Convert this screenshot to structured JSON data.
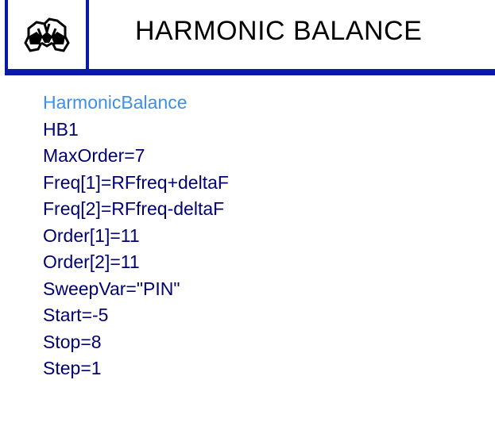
{
  "colors": {
    "accent": "#0a1aa8",
    "component_type": "#3f8fe6",
    "parameter_text": "#000070",
    "title_text": "#000000",
    "background": "#ffffff"
  },
  "header": {
    "icon": "harmonic-balance-simulation-icon",
    "title": "HARMONIC BALANCE"
  },
  "component": {
    "type": "HarmonicBalance",
    "instance": "HB1",
    "parameters": [
      "MaxOrder=7",
      "Freq[1]=RFfreq+deltaF",
      "Freq[2]=RFfreq-deltaF",
      "Order[1]=11",
      "Order[2]=11",
      "SweepVar=\"PIN\"",
      "Start=-5",
      "Stop=8",
      "Step=1"
    ]
  }
}
